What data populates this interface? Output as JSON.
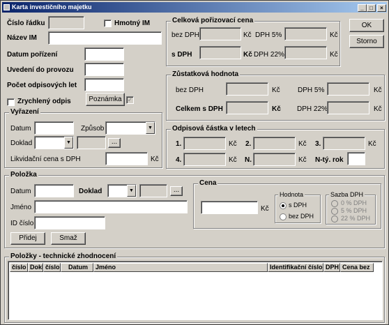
{
  "window": {
    "title": "Karta investičního majetku",
    "controls": [
      "_",
      "□",
      "×"
    ]
  },
  "top": {
    "cislo_radku": "Číslo řádku",
    "hmotny_im": "Hmotný IM",
    "nazev_im": "Název IM",
    "datum_porizeni": "Datum pořízení",
    "uvedeni": "Uvedení do provozu",
    "pocet_let": "Počet odpisových let",
    "zrychleny": "Zrychlený odpis",
    "poznamka": "Poznámka"
  },
  "buttons": {
    "ok": "OK",
    "storno": "Storno",
    "pridej": "Přidej",
    "smaz": "Smaž",
    "ellipsis": "..."
  },
  "celkova": {
    "title": "Celková pořizovací cena",
    "bez_dph": "bez DPH",
    "s_dph": "s DPH",
    "kc": "Kč",
    "dph5": "DPH  5%",
    "dph22": "DPH 22%"
  },
  "zustatkova": {
    "title": "Zůstatková hodnota",
    "bez_dph": "bez DPH",
    "celkem": "Celkem s DPH",
    "kc": "Kč",
    "dph5": "DPH  5%",
    "dph22": "DPH 22%"
  },
  "vyrazeni": {
    "title": "Vyřazení",
    "datum": "Datum",
    "zpusob": "Způsob",
    "doklad": "Doklad",
    "likvidacni": "Likvidační cena s DPH",
    "kc": "Kč"
  },
  "odpisova": {
    "title": "Odpisová částka v letech",
    "l1": "1.",
    "l2": "2.",
    "l3": "3.",
    "l4": "4.",
    "ln": "N.",
    "nty": "N-tý. rok",
    "kc": "Kč"
  },
  "polozka": {
    "title": "Položka",
    "datum": "Datum",
    "doklad": "Doklad",
    "jmeno": "Jméno",
    "id": "ID číslo"
  },
  "cena": {
    "title": "Cena",
    "kc": "Kč",
    "hodnota": "Hodnota",
    "s_dph": "s DPH",
    "bez_dph": "bez DPH",
    "sazba": "Sazba DPH",
    "r0": "0 % DPH",
    "r5": "5 % DPH",
    "r22": "22 % DPH"
  },
  "technicke": {
    "title": "Položky - technické zhodnocení",
    "columns": [
      "číslo",
      "Dokl",
      "číslo",
      "Datum",
      "Jméno",
      "Identifikační číslo",
      "DPH",
      "Cena bez"
    ]
  }
}
